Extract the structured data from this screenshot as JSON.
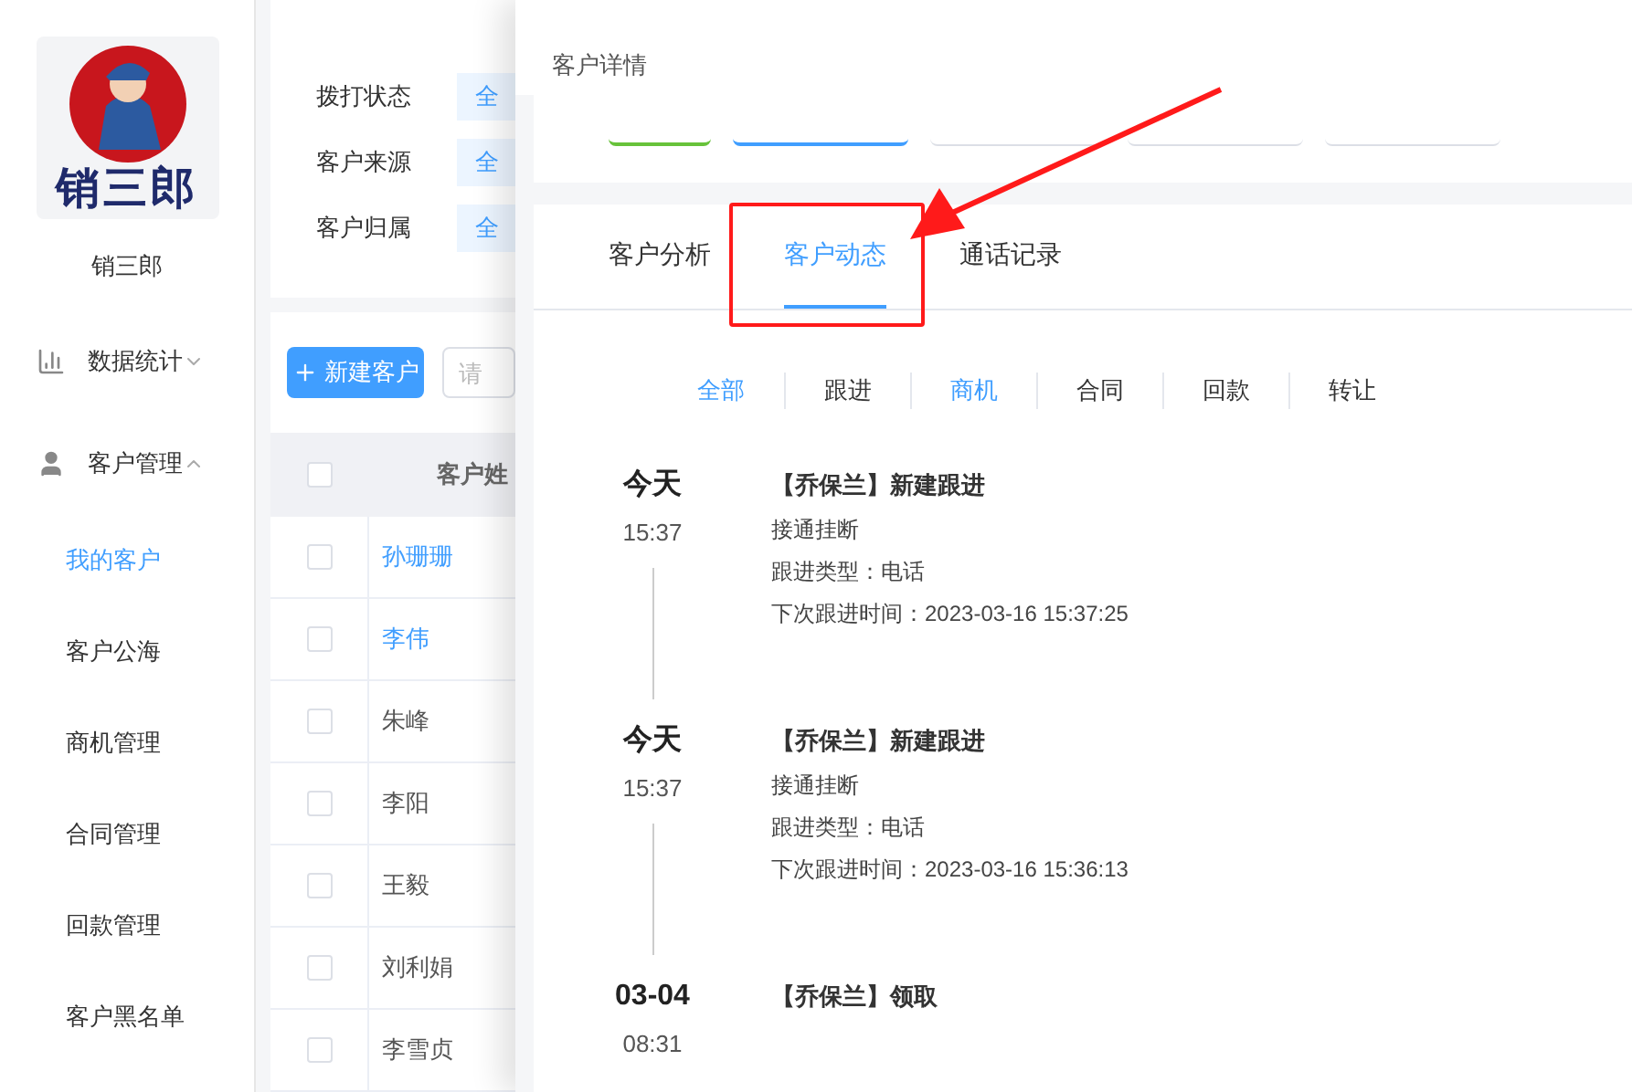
{
  "sidebar": {
    "logo_text": "销三郎",
    "user_name": "销三郎",
    "menu": [
      {
        "label": "数据统计",
        "kind": "chart",
        "expanded": false
      },
      {
        "label": "客户管理",
        "kind": "user",
        "expanded": true,
        "children": [
          {
            "label": "我的客户",
            "selected": true
          },
          {
            "label": "客户公海",
            "selected": false
          },
          {
            "label": "商机管理",
            "selected": false
          },
          {
            "label": "合同管理",
            "selected": false
          },
          {
            "label": "回款管理",
            "selected": false
          },
          {
            "label": "客户黑名单",
            "selected": false
          }
        ]
      }
    ]
  },
  "filters": [
    {
      "label": "拨打状态",
      "value": "全"
    },
    {
      "label": "客户来源",
      "value": "全"
    },
    {
      "label": "客户归属",
      "value": "全"
    }
  ],
  "toolbar": {
    "new_button": "新建客户",
    "search": {
      "placeholder": "请"
    }
  },
  "table": {
    "header_checked": false,
    "columns": [
      "客户姓"
    ],
    "rows": [
      {
        "name": "孙珊珊",
        "link": true,
        "checked": false
      },
      {
        "name": "李伟",
        "link": true,
        "checked": false
      },
      {
        "name": "朱峰",
        "link": false,
        "checked": false
      },
      {
        "name": "李阳",
        "link": false,
        "checked": false
      },
      {
        "name": "王毅",
        "link": false,
        "checked": false
      },
      {
        "name": "刘利娟",
        "link": false,
        "checked": false
      },
      {
        "name": "李雪贞",
        "link": false,
        "checked": false
      }
    ]
  },
  "drawer": {
    "title": "客户详情",
    "action_buttons": [
      {
        "kind": "success"
      },
      {
        "kind": "primary"
      },
      {
        "kind": "default"
      },
      {
        "kind": "default"
      },
      {
        "kind": "default"
      }
    ],
    "tabs": [
      {
        "label": "客户分析",
        "selected": false
      },
      {
        "label": "客户动态",
        "selected": true
      },
      {
        "label": "通话记录",
        "selected": false
      }
    ],
    "filter_tabs": [
      {
        "label": "全部",
        "selected": true
      },
      {
        "label": "跟进",
        "selected": false
      },
      {
        "label": "商机",
        "selected": true
      },
      {
        "label": "合同",
        "selected": false
      },
      {
        "label": "回款",
        "selected": false
      },
      {
        "label": "转让",
        "selected": false
      }
    ],
    "timeline": [
      {
        "date": "今天",
        "time": "15:37",
        "title": "【乔保兰】新建跟进",
        "lines": [
          "接通挂断",
          "跟进类型：电话",
          "下次跟进时间：2023-03-16 15:37:25"
        ]
      },
      {
        "date": "今天",
        "time": "15:37",
        "title": "【乔保兰】新建跟进",
        "lines": [
          "接通挂断",
          "跟进类型：电话",
          "下次跟进时间：2023-03-16 15:36:13"
        ]
      },
      {
        "date": "03-04",
        "time": "08:31",
        "title": "【乔保兰】领取"
      }
    ]
  }
}
